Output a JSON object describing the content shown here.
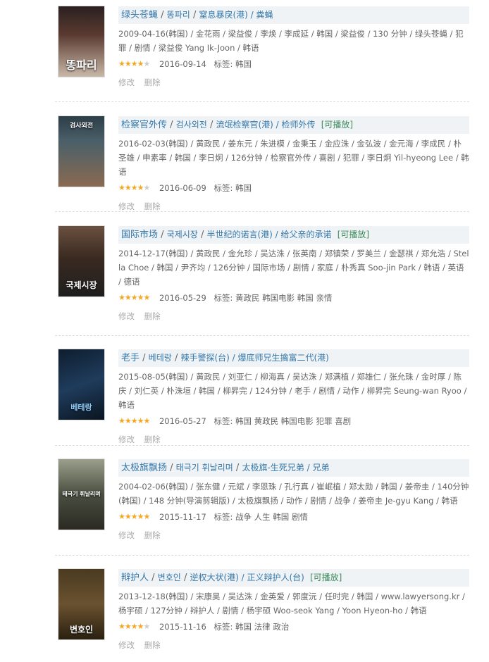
{
  "ops": {
    "edit": "修改",
    "delete": "删除"
  },
  "tags_prefix": "标签: ",
  "items": [
    {
      "title_main": "绿头苍蝇",
      "title_alt": "똥파리",
      "title_other": "窒息暴戾(港) / 粪蝇",
      "playable": "",
      "poster_text": "똥파리",
      "intro": "2009-04-16(韩国) / 金花雨 / 梁益俊 / 李焕 / 李成延 / 韩国 / 梁益俊 / 130 分钟 / 绿头苍蝇 / 犯罪 / 剧情 / 梁益俊 Yang Ik-Joon / 韩语",
      "rating": 4,
      "date": "2016-09-14",
      "tags": "韩国"
    },
    {
      "title_main": "检察官外传",
      "title_alt": "검사외전",
      "title_other": "流氓检察官(港) / 检师外传",
      "playable": "[可播放]",
      "poster_text": "검사외전",
      "intro": "2016-02-03(韩国) / 黄政民 / 姜东元 / 朱进模 / 金秉玉 / 金应洙 / 金弘波 / 金元海 / 李成民 / 朴圣雄 / 申素率 / 韩国 / 李日炯 / 126分钟 / 检察官外传 / 喜剧 / 犯罪 / 李日炯 Yil-hyeong Lee / 韩语",
      "rating": 4,
      "date": "2016-06-09",
      "tags": "韩国"
    },
    {
      "title_main": "国际市场",
      "title_alt": "국제시장",
      "title_other": "半世纪的诺言(港) / 给父亲的承诺",
      "playable": "[可播放]",
      "poster_text": "국제시장",
      "intro": "2014-12-17(韩国) / 黄政民 / 金允珍 / 吴达洙 / 张英南 / 郑镇荣 / 罗美兰 / 金瑟祺 / 郑允浩 / Stella Choe / 韩国 / 尹齐均 / 126分钟 / 国际市场 / 剧情 / 家庭 / 朴秀真 Soo-jin Park / 韩语 / 英语 / 德语",
      "rating": 5,
      "date": "2016-05-29",
      "tags": "黄政民 韩国电影 韩国 亲情"
    },
    {
      "title_main": "老手",
      "title_alt": "베테랑",
      "title_other": "辣手警探(台) / 爆底师兄生擒富二代(港)",
      "playable": "",
      "poster_text": "베테랑",
      "intro": "2015-08-05(韩国) / 黄政民 / 刘亚仁 / 柳海真 / 吴达洙 / 郑满植 / 郑雄仁 / 张允珠 / 金时厚 / 陈庆 / 刘仁英 / 朴洙垣 / 韩国 / 柳昇完 / 124分钟 / 老手 / 剧情 / 动作 / 柳昇完 Seung-wan Ryoo / 韩语",
      "rating": 5,
      "date": "2016-05-27",
      "tags": "韩国 黄政民 韩国电影 犯罪 喜剧"
    },
    {
      "title_main": "太极旗飘扬",
      "title_alt": "태극기 휘날리며",
      "title_other": "太极旗-生死兄弟 / 兄弟",
      "playable": "",
      "poster_text": "태극기 휘날리며",
      "intro": "2004-02-06(韩国) / 张东健 / 元斌 / 李恩珠 / 孔行真 / 崔岷植 / 郑太勋 / 韩国 / 姜帝圭 / 140分钟(韩国) / 148 分钟(导演剪辑版) / 太极旗飘扬 / 动作 / 剧情 / 战争 / 姜帝圭 Je-gyu Kang / 韩语",
      "rating": 5,
      "date": "2015-11-17",
      "tags": "战争 人生 韩国 剧情"
    },
    {
      "title_main": "辩护人",
      "title_alt": "변호인",
      "title_other": "逆权大状(港) / 正义辩护人(台)",
      "playable": "[可播放]",
      "poster_text": "변호인",
      "intro": "2013-12-18(韩国) / 宋康昊 / 吴达洙 / 金英爱 / 郭度沅 / 任时完 / 韩国 / www.lawyersong.kr / 杨宇硕 / 127分钟 / 辩护人 / 剧情 / 杨宇硕 Woo-seok Yang / Yoon Hyeon-ho / 韩语",
      "rating": 4,
      "date": "2015-11-16",
      "tags": "韩国 法律 政治"
    }
  ]
}
